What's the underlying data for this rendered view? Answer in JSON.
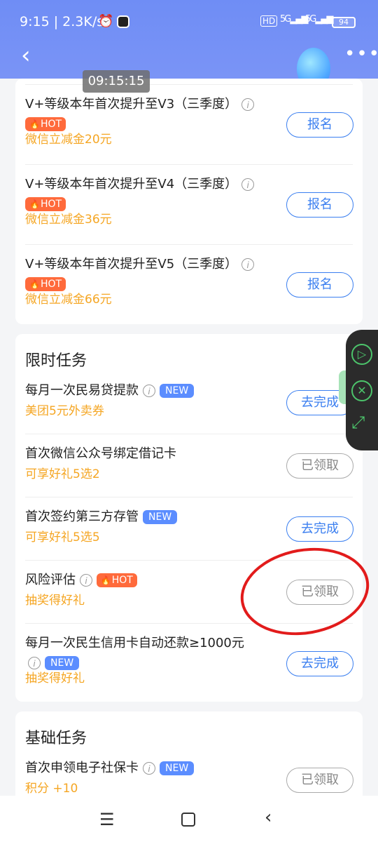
{
  "status": {
    "time": "9:15 | 2.3K/s",
    "alarm_icon": "⏰",
    "hd": "HD",
    "sig1": "5G",
    "sig2": "5G",
    "battery": "94"
  },
  "header": {
    "back_icon": "‹",
    "more_icon": "•••"
  },
  "timestamp": "09:15:15",
  "top_card": {
    "items": [
      {
        "title": "V+等级本年首次提升至V3（三季度）",
        "tag": "HOT",
        "sub": "微信立减金20元",
        "button": "报名"
      },
      {
        "title": "V+等级本年首次提升至V4（三季度）",
        "tag": "HOT",
        "sub": "微信立减金36元",
        "button": "报名"
      },
      {
        "title": "V+等级本年首次提升至V5（三季度）",
        "tag": "HOT",
        "sub": "微信立减金66元",
        "button": "报名"
      }
    ]
  },
  "limited": {
    "title": "限时任务",
    "items": [
      {
        "title": "每月一次民易贷提款",
        "tag": "NEW",
        "sub": "美团5元外卖券",
        "button": "去完成"
      },
      {
        "title": "首次微信公众号绑定借记卡",
        "sub": "可享好礼5选2",
        "button": "已领取"
      },
      {
        "title": "首次签约第三方存管",
        "tag": "NEW",
        "sub": "可享好礼5选5",
        "button": "去完成"
      },
      {
        "title": "风险评估",
        "tag": "HOT",
        "sub": "抽奖得好礼",
        "button": "已领取"
      },
      {
        "title": "每月一次民生信用卡自动还款≥1000元",
        "tag": "NEW",
        "sub": "抽奖得好礼",
        "button": "去完成"
      }
    ]
  },
  "basic": {
    "title": "基础任务",
    "items": [
      {
        "title": "首次申领电子社保卡",
        "tag": "NEW",
        "sub": "积分 +10",
        "button": "已领取"
      }
    ]
  },
  "floatbar": {
    "play_icon": "▷",
    "close_icon": "✕",
    "expand_icon": "⤢"
  },
  "nav": {
    "menu_icon": "☰",
    "back_icon": "‹"
  },
  "colors": {
    "primary": "#3b7ff0",
    "header": "#6f8df5",
    "orange": "#f5a623",
    "hot": "#ff6a3b",
    "new": "#5b8dff",
    "circle": "#e21b1b"
  }
}
